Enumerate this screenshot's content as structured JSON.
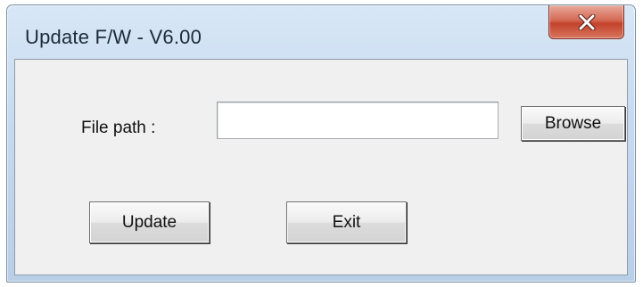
{
  "window": {
    "title": "Update F/W - V6.00",
    "close_icon": "close-x-icon"
  },
  "form": {
    "file_path_label": "File path :",
    "file_path_value": "",
    "browse_label": "Browse"
  },
  "actions": {
    "update_label": "Update",
    "exit_label": "Exit"
  },
  "colors": {
    "titlebar": "#c5d9ef",
    "close_button": "#c2432c",
    "client_background": "#f0f0f0"
  }
}
